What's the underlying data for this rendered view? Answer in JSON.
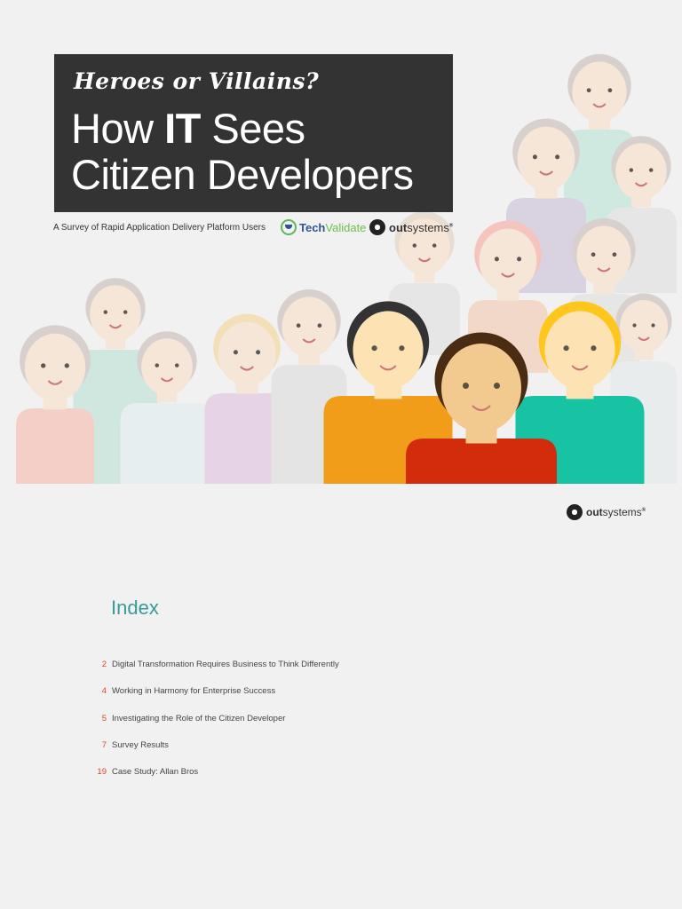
{
  "cover": {
    "kicker": "Heroes or Villains?",
    "headline_pre": "How ",
    "headline_bold": "IT",
    "headline_post": " Sees",
    "headline_line2": "Citizen Developers",
    "subtitle": "A Survey of Rapid Application Delivery Platform Users"
  },
  "logos": {
    "techvalidate_a": "Tech",
    "techvalidate_b": "Validate",
    "outsystems_a": "out",
    "outsystems_b": "systems"
  },
  "index": {
    "title": "Index",
    "items": [
      {
        "page": "2",
        "label": "Digital Transformation Requires Business to Think Differently"
      },
      {
        "page": "4",
        "label": "Working in Harmony for Enterprise Success"
      },
      {
        "page": "5",
        "label": "Investigating the Role of the Citizen Developer"
      },
      {
        "page": "7",
        "label": "Survey Results"
      },
      {
        "page": "19",
        "label": "Case Study: Allan Bros"
      }
    ]
  },
  "colors": {
    "title_bg": "#333333",
    "index_accent": "#3a9a9a",
    "page_number": "#d9472b"
  }
}
